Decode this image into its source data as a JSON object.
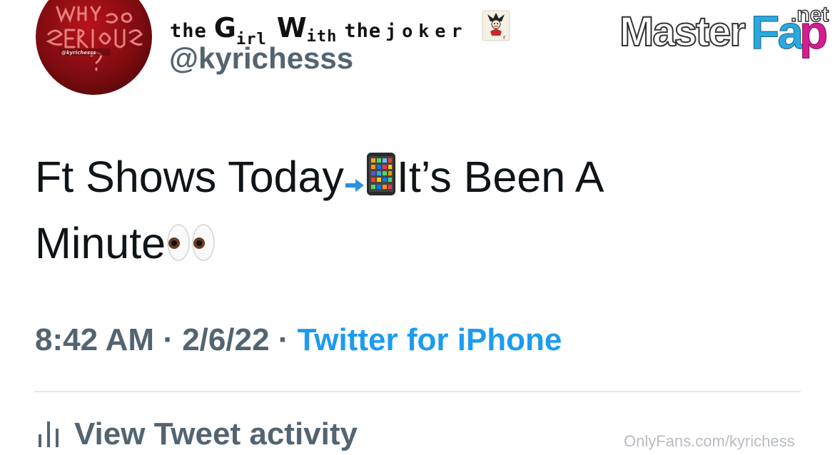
{
  "profile": {
    "display_name": {
      "the": "the",
      "g": "G",
      "irl": "irl",
      "w": "W",
      "ith": "ith",
      "the2": "the",
      "joker": "joker"
    },
    "handle": "@kyrichesss",
    "avatar_text": "WHY SO SERIOUS ?",
    "avatar_sub": "@kyrichesss"
  },
  "logo": {
    "main": "MasterFap",
    "suffix": ".net"
  },
  "tweet": {
    "line1_a": "Ft Shows Today",
    "line1_b": "It’s Been A",
    "line2": "Minute"
  },
  "meta": {
    "time": "8:42 AM",
    "sep1": " · ",
    "date": "2/6/22",
    "sep2": " · ",
    "source": "Twitter for iPhone"
  },
  "activity": {
    "label": "View Tweet activity"
  },
  "watermark": "OnlyFans.com/kyrichess",
  "colors": {
    "accent": "#1d9bf0",
    "muted": "#536471",
    "text": "#0f1419",
    "logo_pink": "#d41e8f",
    "logo_blue": "#2aa9e0"
  }
}
